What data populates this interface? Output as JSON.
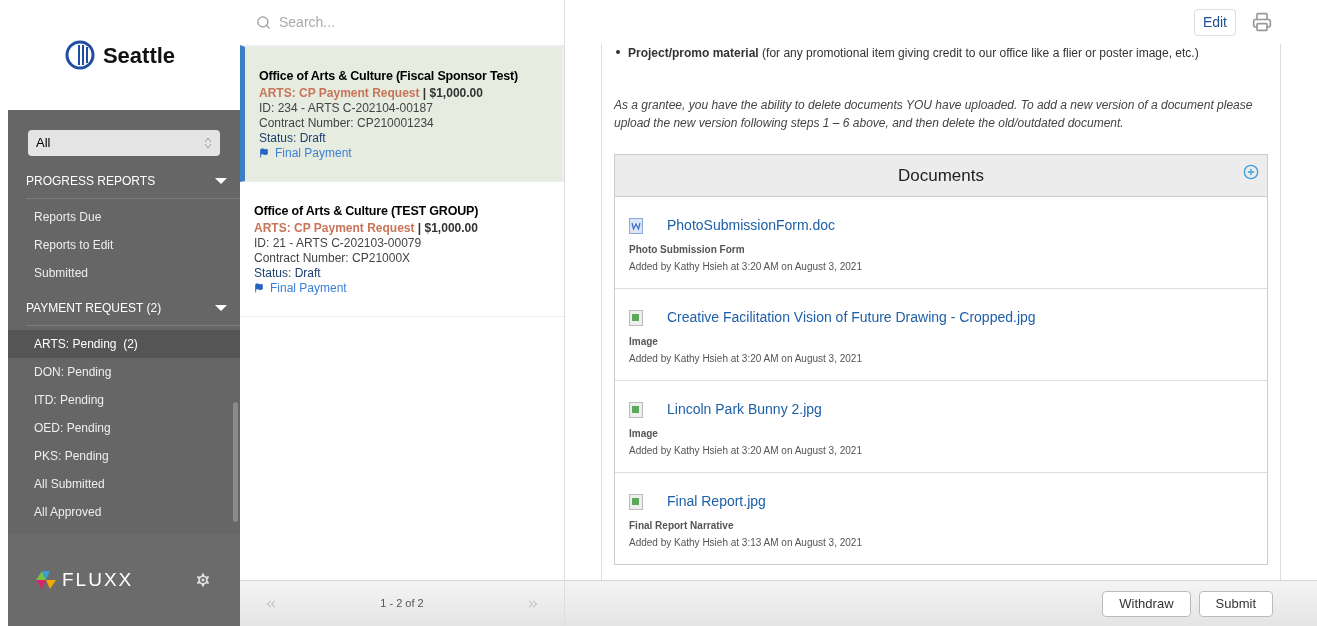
{
  "logo": {
    "text": "Seattle"
  },
  "filter": {
    "value": "All"
  },
  "sidebar": {
    "sections": [
      {
        "title": "PROGRESS REPORTS",
        "expanded": true,
        "items": [
          {
            "label": "Reports Due",
            "selected": false
          },
          {
            "label": "Reports to Edit",
            "selected": false
          },
          {
            "label": "Submitted",
            "selected": false
          }
        ]
      },
      {
        "title": "PAYMENT REQUEST (2)",
        "expanded": true,
        "items": [
          {
            "label": "ARTS: Pending  (2)",
            "selected": true
          },
          {
            "label": "DON: Pending",
            "selected": false
          },
          {
            "label": "ITD: Pending",
            "selected": false
          },
          {
            "label": "OED: Pending",
            "selected": false
          },
          {
            "label": "PKS: Pending",
            "selected": false
          },
          {
            "label": "All Submitted",
            "selected": false
          },
          {
            "label": "All Approved",
            "selected": false
          }
        ]
      }
    ]
  },
  "brand": "FLUXX",
  "search": {
    "placeholder": "Search..."
  },
  "records": [
    {
      "title": "Office of Arts & Culture (Fiscal Sponsor Test)",
      "type": "ARTS: CP Payment Request",
      "amount": "| $1,000.00",
      "id": "ID: 234 - ARTS C-202104-00187",
      "contract": "Contract Number: CP210001234",
      "status": "Status: Draft",
      "flag": "Final Payment",
      "selected": true
    },
    {
      "title": "Office of Arts & Culture (TEST GROUP)",
      "type": "ARTS: CP Payment Request",
      "amount": "| $1,000.00",
      "id": "ID: 21 - ARTS C-202103-00079",
      "contract": "Contract Number: CP21000X",
      "status": "Status: Draft",
      "flag": "Final Payment",
      "selected": false
    }
  ],
  "pager": {
    "text": "1 - 2 of 2"
  },
  "detail": {
    "edit": "Edit",
    "bullet": "**Project/promo material** (for any promotional item giving credit to our office like a flier or poster image, etc.)",
    "note": "As a grantee, you have the ability to delete documents YOU have uploaded.  To add a new version of a document please upload the new version following steps 1 – 6 above, and then delete the old/outdated document.",
    "documents": {
      "title": "Documents",
      "items": [
        {
          "kind": "doc",
          "name": "PhotoSubmissionForm.doc",
          "description": "Photo Submission Form",
          "added": "Added by Kathy Hsieh at 3:20 AM on August 3, 2021"
        },
        {
          "kind": "image",
          "name": "Creative Facilitation Vision of Future Drawing - Cropped.jpg",
          "description": "Image",
          "added": "Added by Kathy Hsieh at 3:20 AM on August 3, 2021"
        },
        {
          "kind": "image",
          "name": "Lincoln Park Bunny 2.jpg",
          "description": "Image",
          "added": "Added by Kathy Hsieh at 3:20 AM on August 3, 2021"
        },
        {
          "kind": "image",
          "name": "Final Report.jpg",
          "description": "Final Report Narrative",
          "added": "Added by Kathy Hsieh at 3:13 AM on August 3, 2021"
        }
      ]
    }
  },
  "actions": [
    "Withdraw",
    "Submit"
  ]
}
